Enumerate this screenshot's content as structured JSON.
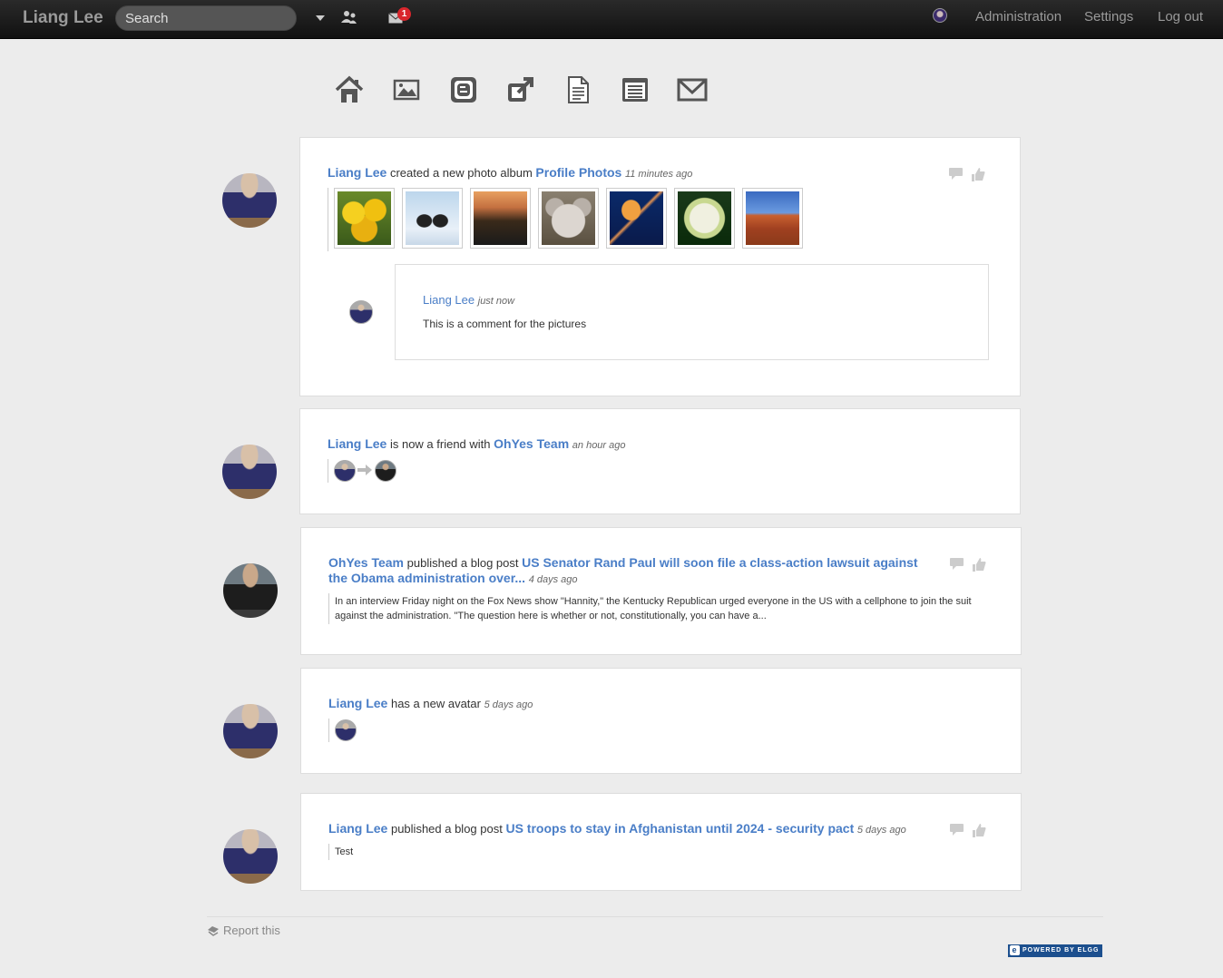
{
  "topbar": {
    "brand": "Liang Lee",
    "search_placeholder": "Search",
    "mail_count": "1",
    "nav": [
      "Administration",
      "Settings",
      "Log out"
    ]
  },
  "toolbar": [
    "home-icon",
    "photo-icon",
    "blog-icon",
    "share-icon",
    "file-icon",
    "pages-icon",
    "mail-icon"
  ],
  "feed": [
    {
      "actor": "Liang Lee",
      "verb": " created a new photo album ",
      "object": "Profile Photos",
      "time": "11 minutes ago",
      "comment": {
        "author": "Liang Lee",
        "time": "just now",
        "text": "This is a comment for the pictures"
      }
    },
    {
      "actor": "Liang Lee",
      "verb": " is now a friend with ",
      "object": "OhYes Team",
      "time": "an hour ago"
    },
    {
      "actor": "OhYes Team",
      "verb": " published a blog post ",
      "object": "US Senator Rand Paul will soon file a class-action lawsuit against the Obama administration over...",
      "time": "4 days ago",
      "excerpt": "In an interview Friday night on the Fox News show \"Hannity,\" the Kentucky Republican urged everyone in the US with a cellphone to join the suit against the administration. \"The question here is whether or not, constitutionally, you can have a..."
    },
    {
      "actor": "Liang Lee",
      "verb": " has a new avatar ",
      "object": "",
      "time": "5 days ago"
    },
    {
      "actor": "Liang Lee",
      "verb": " published a blog post ",
      "object": "US troops to stay in Afghanistan until 2024 - security pact",
      "time": "5 days ago",
      "excerpt": "Test"
    }
  ],
  "footer": {
    "report": "Report this",
    "powered": "POWERED BY ELGG"
  },
  "colors": {
    "link": "#4a7ec7",
    "badge": "#d9262c",
    "topbar": "#1a1a1a"
  }
}
